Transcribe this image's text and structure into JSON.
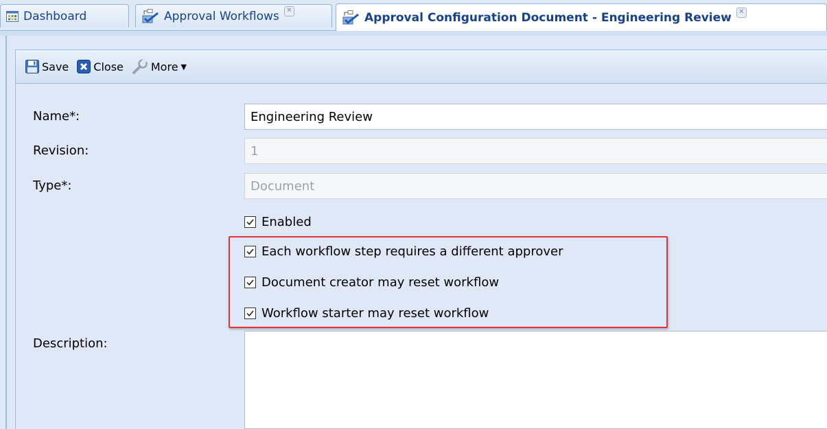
{
  "tabs": [
    {
      "label": "Dashboard",
      "icon": "dashboard-icon",
      "closable": false
    },
    {
      "label": "Approval Workflows",
      "icon": "workflow-icon",
      "closable": true
    },
    {
      "label": "Approval Configuration Document - Engineering Review",
      "icon": "workflow-icon",
      "closable": true,
      "active": true
    }
  ],
  "toolbar": {
    "save_label": "Save",
    "close_label": "Close",
    "more_label": "More"
  },
  "form": {
    "name_label": "Name*:",
    "name_value": "Engineering Review",
    "revision_label": "Revision:",
    "revision_value": "1",
    "type_label": "Type*:",
    "type_value": "Document",
    "description_label": "Description:",
    "description_value": ""
  },
  "checkboxes": [
    {
      "label": "Enabled",
      "checked": true
    },
    {
      "label": "Each workflow step requires a different approver",
      "checked": true
    },
    {
      "label": "Document creator may reset workflow",
      "checked": true
    },
    {
      "label": "Workflow starter may reset workflow",
      "checked": true
    }
  ],
  "colors": {
    "highlight_border": "#e0343c",
    "tab_text": "#15428b",
    "panel_bg": "#dfe8f6"
  }
}
